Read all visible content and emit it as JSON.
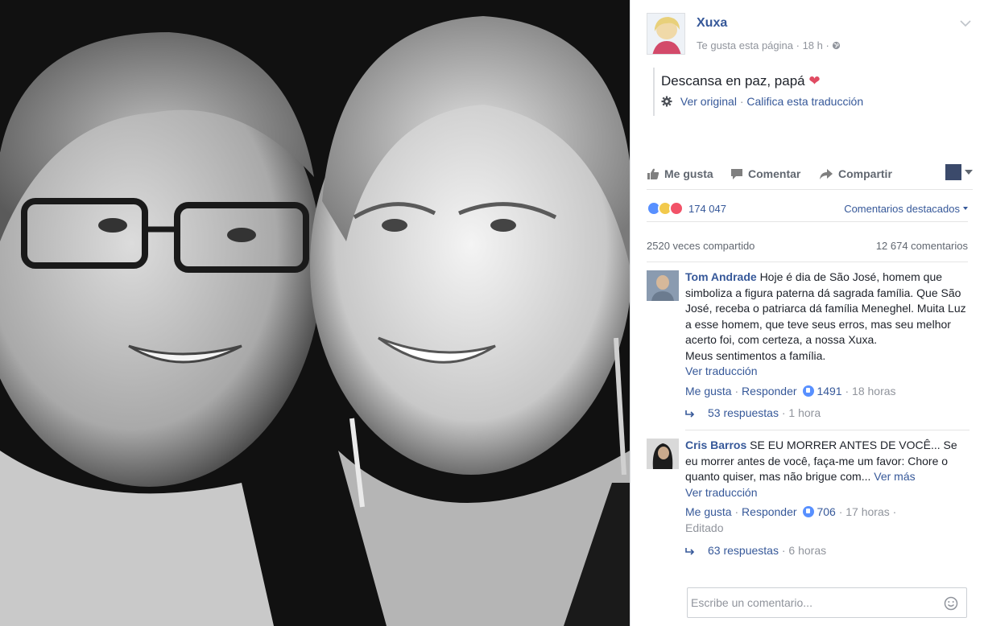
{
  "post": {
    "page_name": "Xuxa",
    "meta_like": "Te gusta esta página",
    "meta_time": "18 h",
    "text": "Descansa en paz, papá",
    "view_original": "Ver original",
    "rate_translation": "Califica esta traducción"
  },
  "actions": {
    "like": "Me gusta",
    "comment": "Comentar",
    "share": "Compartir"
  },
  "reactions": {
    "count": "174 047",
    "featured_comments": "Comentarios destacados"
  },
  "stats": {
    "shares": "2520 veces compartido",
    "comments": "12 674 comentarios"
  },
  "comments": [
    {
      "author": "Tom Andrade",
      "text": "Hoje é dia de São José, homem que simboliza a figura paterna dá sagrada família. Que São José, receba o patriarca dá família Meneghel. Muita Luz a esse homem, que teve seus erros, mas seu melhor acerto foi, com certeza, a nossa Xuxa.",
      "text2": "Meus sentimentos a família.",
      "see_translation": "Ver traducción",
      "like": "Me gusta",
      "reply": "Responder",
      "likes": "1491",
      "time": "18 horas",
      "replies": "53 respuestas",
      "replies_time": "1 hora"
    },
    {
      "author": "Cris Barros",
      "text": "SE EU MORRER ANTES DE VOCÊ... Se eu morrer antes de você, faça-me um favor: Chore o quanto quiser, mas não brigue com...",
      "see_more": "Ver más",
      "see_translation": "Ver traducción",
      "like": "Me gusta",
      "reply": "Responder",
      "likes": "706",
      "time": "17 horas",
      "edited": "Editado",
      "replies": "63 respuestas",
      "replies_time": "6 horas"
    }
  ],
  "composer": {
    "placeholder": "Escribe un comentario..."
  },
  "colors": {
    "link": "#365899",
    "muted": "#90949c",
    "text": "#1d2129",
    "love": "#f25268",
    "like": "#5890ff"
  }
}
